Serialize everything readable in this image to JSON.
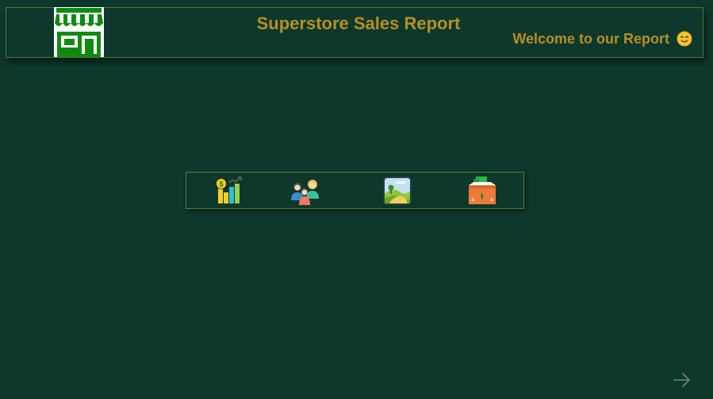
{
  "header": {
    "title": "Superstore Sales Report",
    "welcome": "Welcome to our Report",
    "logo_icon": "store-icon",
    "welcome_emoji": "smiling-face-icon"
  },
  "nav": {
    "items": [
      {
        "icon": "sales-chart-icon"
      },
      {
        "icon": "customers-icon"
      },
      {
        "icon": "map-icon"
      },
      {
        "icon": "product-box-icon"
      }
    ]
  },
  "footer": {
    "next_icon": "arrow-right-icon"
  },
  "colors": {
    "background": "#0d382b",
    "accent_gold": "#b58f26",
    "border": "#4f7a3d",
    "logo_green": "#108a10"
  }
}
